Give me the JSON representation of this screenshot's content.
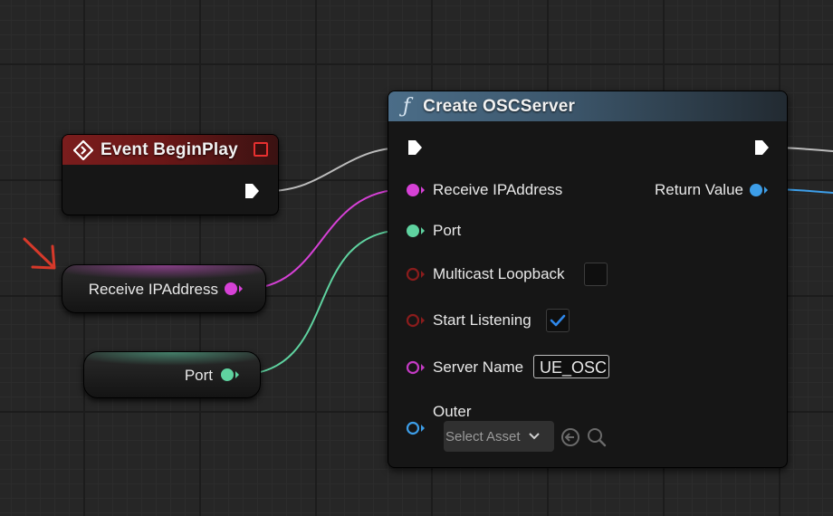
{
  "event_node": {
    "title": "Event BeginPlay"
  },
  "function_node": {
    "title": "Create OSCServer",
    "inputs": {
      "receive_ip": "Receive IPAddress",
      "port": "Port",
      "multicast_loopback": "Multicast Loopback",
      "start_listening": "Start Listening",
      "server_name": "Server Name",
      "outer": "Outer"
    },
    "multicast_loopback_checked": false,
    "start_listening_checked": true,
    "server_name_value": "UE_OSC",
    "outer_select_label": "Select Asset",
    "outputs": {
      "return_value": "Return Value"
    }
  },
  "variables": [
    {
      "label": "Receive IPAddress"
    },
    {
      "label": "Port"
    }
  ],
  "icons": {
    "event": "diamond-icon",
    "function": "function-f-icon",
    "delegate": "delegate-square-icon",
    "use_selected": "arrow-left-circle-icon",
    "browse": "search-icon",
    "annotation": "red-arrow-icon"
  },
  "colors": {
    "exec": "#ffffff",
    "string_pin": "#d641d6",
    "int_pin": "#5fd3a0",
    "bool_pin": "#8a1c1c",
    "name_pin": "#c43bc4",
    "object_pin": "#3d9ee8",
    "event_header": "#7a1d1d",
    "function_header": "#4b6d88",
    "checkbox_tick": "#2f88ea",
    "annotation_arrow": "#d6392a"
  }
}
